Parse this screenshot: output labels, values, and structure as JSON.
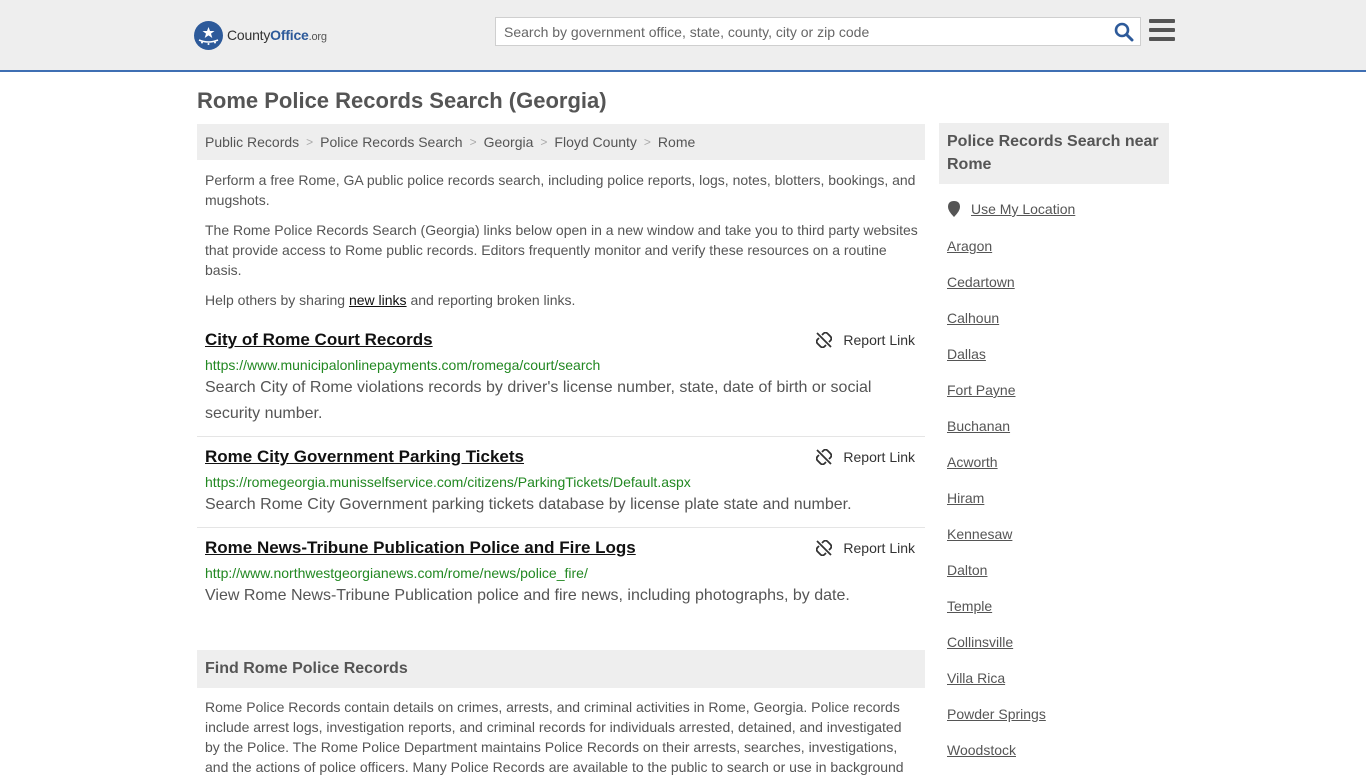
{
  "header": {
    "logo_brand": "County",
    "logo_office": "Office",
    "logo_tld": ".org",
    "search_placeholder": "Search by government office, state, county, city or zip code"
  },
  "page": {
    "title": "Rome Police Records Search (Georgia)"
  },
  "breadcrumb": [
    "Public Records",
    "Police Records Search",
    "Georgia",
    "Floyd County",
    "Rome"
  ],
  "intro": {
    "p1": "Perform a free Rome, GA public police records search, including police reports, logs, notes, blotters, bookings, and mugshots.",
    "p2": "The Rome Police Records Search (Georgia) links below open in a new window and take you to third party websites that provide access to Rome public records. Editors frequently monitor and verify these resources on a routine basis.",
    "p3_before": "Help others by sharing ",
    "p3_link": "new links",
    "p3_after": " and reporting broken links."
  },
  "report_label": "Report Link",
  "entries": [
    {
      "title": "City of Rome Court Records",
      "url": "https://www.municipalonlinepayments.com/romega/court/search",
      "description": "Search City of Rome violations records by driver's license number, state, date of birth or social security number."
    },
    {
      "title": "Rome City Government Parking Tickets",
      "url": "https://romegeorgia.munisselfservice.com/citizens/ParkingTickets/Default.aspx",
      "description": "Search Rome City Government parking tickets database by license plate state and number."
    },
    {
      "title": "Rome News-Tribune Publication Police and Fire Logs",
      "url": "http://www.northwestgeorgianews.com/rome/news/police_fire/",
      "description": "View Rome News-Tribune Publication police and fire news, including photographs, by date."
    }
  ],
  "find_section": {
    "heading": "Find Rome Police Records",
    "body": "Rome Police Records contain details on crimes, arrests, and criminal activities in Rome, Georgia. Police records include arrest logs, investigation reports, and criminal records for individuals arrested, detained, and investigated by the Police. The Rome Police Department maintains Police Records on their arrests, searches, investigations, and the actions of police officers. Many Police Records are available to the public to search or use in background"
  },
  "sidebar": {
    "heading": "Police Records Search near Rome",
    "use_location": "Use My Location",
    "cities": [
      "Aragon",
      "Cedartown",
      "Calhoun",
      "Dallas",
      "Fort Payne",
      "Buchanan",
      "Acworth",
      "Hiram",
      "Kennesaw",
      "Dalton",
      "Temple",
      "Collinsville",
      "Villa Rica",
      "Powder Springs",
      "Woodstock"
    ]
  },
  "colors": {
    "accent": "#2d5a9a",
    "url_green": "#228822",
    "header_bg": "#eeeeee"
  }
}
